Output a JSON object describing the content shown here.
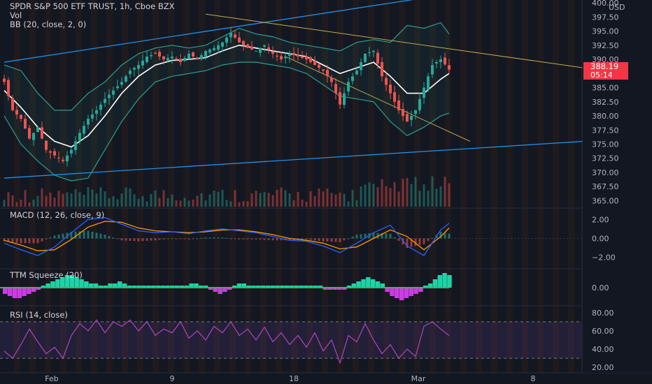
{
  "header": {
    "symbol_line": "SPDR S&P 500 ETF TRUST, 1h, Cboe BZX",
    "vol_label": "Vol",
    "bb_label": "BB (20, close, 2, 0)",
    "currency": "USD"
  },
  "price_tag": {
    "price": "388.19",
    "countdown": "05:14"
  },
  "indicators": {
    "macd_label": "MACD (12, 26, close, 9)",
    "ttm_label": "TTM Squeeze (20)",
    "rsi_label": "RSI (14, close)"
  },
  "colors": {
    "background": "#131722",
    "up": "#26a69a",
    "down": "#ef5350",
    "bb_band": "#2e9e8f",
    "bb_mid": "#ffffff",
    "channel": "#2196f3",
    "wedge": "#c9b458",
    "macd_line": "#2962ff",
    "signal_line": "#ff9800",
    "ttm_pos": "#1de9b6",
    "ttm_neg": "#e040fb",
    "rsi_line": "#ab47bc",
    "price_tag": "#f23645"
  },
  "chart_data": [
    {
      "type": "candlestick",
      "pane": "price",
      "title": "SPDR S&P 500 ETF TRUST, 1h, Cboe BZX",
      "ylabel": "USD",
      "ylim": [
        365,
        400
      ],
      "yticks": [
        365.0,
        367.5,
        370.0,
        372.5,
        375.0,
        377.5,
        380.0,
        382.5,
        385.0,
        387.5,
        390.0,
        392.5,
        395.0,
        397.5,
        400.0
      ],
      "yticklabels": [
        "365.00",
        "367.50",
        "370.00",
        "372.50",
        "375.00",
        "377.50",
        "380.00",
        "382.50",
        "385.00",
        "",
        "390.00",
        "392.50",
        "395.00",
        "397.50",
        "400.00"
      ],
      "xticklabels": [
        "Feb",
        "9",
        "18",
        "Mar",
        "8"
      ],
      "last_price": 388.19,
      "close_path": [
        [
          0,
          386
        ],
        [
          2,
          381
        ],
        [
          4,
          379.5
        ],
        [
          6,
          376
        ],
        [
          8,
          378
        ],
        [
          10,
          374
        ],
        [
          12,
          373
        ],
        [
          14,
          372
        ],
        [
          16,
          374
        ],
        [
          18,
          377
        ],
        [
          20,
          379.5
        ],
        [
          22,
          381
        ],
        [
          24,
          383
        ],
        [
          26,
          384.5
        ],
        [
          28,
          386
        ],
        [
          30,
          388
        ],
        [
          32,
          389
        ],
        [
          34,
          390.5
        ],
        [
          36,
          391
        ],
        [
          38,
          390
        ],
        [
          40,
          390.5
        ],
        [
          42,
          389.5
        ],
        [
          44,
          391
        ],
        [
          46,
          390
        ],
        [
          48,
          391.5
        ],
        [
          50,
          392
        ],
        [
          52,
          393
        ],
        [
          54,
          394.7
        ],
        [
          56,
          393
        ],
        [
          58,
          392
        ],
        [
          60,
          391.5
        ],
        [
          62,
          392.5
        ],
        [
          64,
          391
        ],
        [
          66,
          390
        ],
        [
          68,
          391
        ],
        [
          70,
          390.5
        ],
        [
          72,
          390
        ],
        [
          74,
          389
        ],
        [
          76,
          388
        ],
        [
          78,
          386
        ],
        [
          80,
          382
        ],
        [
          82,
          386
        ],
        [
          84,
          388
        ],
        [
          86,
          391
        ],
        [
          88,
          391.5
        ],
        [
          90,
          387
        ],
        [
          92,
          384
        ],
        [
          94,
          381
        ],
        [
          96,
          379
        ],
        [
          98,
          381
        ],
        [
          100,
          385
        ],
        [
          102,
          389
        ],
        [
          104,
          390
        ],
        [
          106,
          388.19
        ]
      ],
      "bb_upper": [
        [
          0,
          389
        ],
        [
          4,
          388
        ],
        [
          8,
          384
        ],
        [
          12,
          381
        ],
        [
          16,
          381
        ],
        [
          20,
          384
        ],
        [
          24,
          386
        ],
        [
          28,
          389
        ],
        [
          32,
          391
        ],
        [
          36,
          392
        ],
        [
          40,
          392.5
        ],
        [
          44,
          392
        ],
        [
          48,
          392.5
        ],
        [
          52,
          394
        ],
        [
          56,
          395.5
        ],
        [
          60,
          394.5
        ],
        [
          64,
          394
        ],
        [
          68,
          393
        ],
        [
          72,
          392.5
        ],
        [
          76,
          392
        ],
        [
          80,
          391.5
        ],
        [
          84,
          393
        ],
        [
          88,
          393.5
        ],
        [
          92,
          393
        ],
        [
          96,
          396
        ],
        [
          100,
          395.5
        ],
        [
          104,
          396.5
        ],
        [
          106,
          394.5
        ]
      ],
      "bb_middle": [
        [
          0,
          384.5
        ],
        [
          4,
          381.5
        ],
        [
          8,
          378
        ],
        [
          12,
          375.5
        ],
        [
          16,
          374.5
        ],
        [
          20,
          376.5
        ],
        [
          24,
          380
        ],
        [
          28,
          384
        ],
        [
          32,
          387
        ],
        [
          36,
          389
        ],
        [
          40,
          389.8
        ],
        [
          44,
          390
        ],
        [
          48,
          390.3
        ],
        [
          52,
          391.5
        ],
        [
          56,
          392.5
        ],
        [
          60,
          392
        ],
        [
          64,
          391.5
        ],
        [
          68,
          391
        ],
        [
          72,
          390.5
        ],
        [
          76,
          389
        ],
        [
          80,
          387.5
        ],
        [
          84,
          388.5
        ],
        [
          88,
          389.5
        ],
        [
          92,
          387
        ],
        [
          96,
          384
        ],
        [
          100,
          384
        ],
        [
          104,
          386.5
        ],
        [
          106,
          387.5
        ]
      ],
      "bb_lower": [
        [
          0,
          380
        ],
        [
          4,
          375
        ],
        [
          8,
          372
        ],
        [
          12,
          369.5
        ],
        [
          16,
          368.5
        ],
        [
          20,
          369
        ],
        [
          24,
          374
        ],
        [
          28,
          379
        ],
        [
          32,
          383
        ],
        [
          36,
          386
        ],
        [
          40,
          387
        ],
        [
          44,
          387.5
        ],
        [
          48,
          388
        ],
        [
          52,
          389
        ],
        [
          56,
          389.5
        ],
        [
          60,
          389.5
        ],
        [
          64,
          389
        ],
        [
          68,
          388.5
        ],
        [
          72,
          387.5
        ],
        [
          76,
          385.5
        ],
        [
          80,
          383.5
        ],
        [
          84,
          383
        ],
        [
          88,
          382.5
        ],
        [
          92,
          379
        ],
        [
          96,
          376.5
        ],
        [
          100,
          378
        ],
        [
          104,
          380
        ],
        [
          106,
          380.5
        ]
      ],
      "trendlines": [
        {
          "name": "channel-upper",
          "from": [
            0,
            389.5
          ],
          "to": [
            110,
            402
          ]
        },
        {
          "name": "channel-lower",
          "from": [
            0,
            369
          ],
          "to": [
            138,
            375.5
          ]
        },
        {
          "name": "wedge-upper",
          "from": [
            48,
            398
          ],
          "to": [
            138,
            388.5
          ]
        },
        {
          "name": "wedge-lower",
          "from": [
            67,
            390.5
          ],
          "to": [
            111,
            375.5
          ]
        }
      ]
    },
    {
      "type": "line",
      "pane": "macd",
      "title": "MACD (12, 26, close, 9)",
      "ylim": [
        -3,
        3
      ],
      "yticklabels": [
        "−2.00",
        "0.00",
        "2.00"
      ],
      "yticks": [
        -2,
        0,
        2
      ],
      "series": [
        {
          "values": [
            [
              0,
              -0.5
            ],
            [
              4,
              -1.2
            ],
            [
              8,
              -1.8
            ],
            [
              12,
              -0.9
            ],
            [
              16,
              0.6
            ],
            [
              20,
              2.0
            ],
            [
              24,
              2.2
            ],
            [
              28,
              1.5
            ],
            [
              32,
              0.8
            ],
            [
              36,
              0.6
            ],
            [
              40,
              0.7
            ],
            [
              44,
              0.5
            ],
            [
              48,
              0.8
            ],
            [
              52,
              1.0
            ],
            [
              56,
              0.8
            ],
            [
              60,
              0.6
            ],
            [
              64,
              0.2
            ],
            [
              68,
              -0.2
            ],
            [
              72,
              -0.3
            ],
            [
              76,
              -0.8
            ],
            [
              80,
              -1.5
            ],
            [
              84,
              -0.5
            ],
            [
              88,
              0.6
            ],
            [
              92,
              1.4
            ],
            [
              96,
              -0.8
            ],
            [
              100,
              -1.8
            ],
            [
              104,
              0.9
            ],
            [
              106,
              1.6
            ]
          ]
        },
        {
          "values": [
            [
              0,
              -0.2
            ],
            [
              4,
              -0.7
            ],
            [
              8,
              -1.3
            ],
            [
              12,
              -1.2
            ],
            [
              16,
              -0.1
            ],
            [
              20,
              1.2
            ],
            [
              24,
              1.8
            ],
            [
              28,
              1.7
            ],
            [
              32,
              1.1
            ],
            [
              36,
              0.8
            ],
            [
              40,
              0.7
            ],
            [
              44,
              0.6
            ],
            [
              48,
              0.7
            ],
            [
              52,
              0.9
            ],
            [
              56,
              0.9
            ],
            [
              60,
              0.7
            ],
            [
              64,
              0.4
            ],
            [
              68,
              0.0
            ],
            [
              72,
              -0.2
            ],
            [
              76,
              -0.5
            ],
            [
              80,
              -1.1
            ],
            [
              84,
              -0.9
            ],
            [
              88,
              0.0
            ],
            [
              92,
              0.9
            ],
            [
              96,
              0.2
            ],
            [
              100,
              -1.2
            ],
            [
              104,
              0.2
            ],
            [
              106,
              1.1
            ]
          ]
        }
      ]
    },
    {
      "type": "bar",
      "pane": "ttm",
      "title": "TTM Squeeze (20)",
      "yticklabels": [
        "0.00"
      ],
      "values": [
        -3,
        -4,
        -5,
        -5,
        -4,
        -3,
        -2,
        -1,
        1,
        2,
        3,
        4,
        5,
        6,
        6,
        5,
        4,
        3,
        2,
        2,
        1,
        1,
        2,
        2,
        3,
        2,
        1,
        1,
        1,
        1,
        1,
        1,
        1,
        1,
        1,
        1,
        1,
        1,
        1,
        2,
        2,
        1,
        1,
        -1,
        -2,
        -3,
        -2,
        -1,
        1,
        2,
        2,
        1,
        1,
        1,
        1,
        1,
        1,
        1,
        1,
        1,
        1,
        1,
        1,
        1,
        1,
        1,
        1,
        -1,
        -1,
        -1,
        -1,
        -1,
        1,
        2,
        3,
        4,
        5,
        4,
        3,
        2,
        -2,
        -4,
        -5,
        -6,
        -5,
        -4,
        -3,
        -2,
        1,
        2,
        4,
        6,
        7,
        6
      ]
    },
    {
      "type": "line",
      "pane": "rsi",
      "title": "RSI (14, close)",
      "ylim": [
        15,
        85
      ],
      "yticks": [
        20,
        40,
        60,
        80
      ],
      "yticklabels": [
        "20.00",
        "40.00",
        "60.00",
        "80.00"
      ],
      "band": [
        30,
        70
      ],
      "values": [
        [
          0,
          38
        ],
        [
          2,
          30
        ],
        [
          4,
          45
        ],
        [
          6,
          62
        ],
        [
          8,
          48
        ],
        [
          10,
          35
        ],
        [
          12,
          42
        ],
        [
          14,
          30
        ],
        [
          16,
          55
        ],
        [
          18,
          68
        ],
        [
          20,
          60
        ],
        [
          22,
          72
        ],
        [
          24,
          58
        ],
        [
          26,
          70
        ],
        [
          28,
          65
        ],
        [
          30,
          72
        ],
        [
          32,
          60
        ],
        [
          34,
          70
        ],
        [
          36,
          55
        ],
        [
          38,
          62
        ],
        [
          40,
          58
        ],
        [
          42,
          70
        ],
        [
          44,
          52
        ],
        [
          46,
          60
        ],
        [
          48,
          50
        ],
        [
          50,
          65
        ],
        [
          52,
          58
        ],
        [
          54,
          70
        ],
        [
          56,
          55
        ],
        [
          58,
          62
        ],
        [
          60,
          50
        ],
        [
          62,
          64
        ],
        [
          64,
          48
        ],
        [
          66,
          58
        ],
        [
          68,
          45
        ],
        [
          70,
          55
        ],
        [
          72,
          42
        ],
        [
          74,
          58
        ],
        [
          76,
          38
        ],
        [
          78,
          50
        ],
        [
          80,
          25
        ],
        [
          82,
          55
        ],
        [
          84,
          48
        ],
        [
          86,
          68
        ],
        [
          88,
          50
        ],
        [
          90,
          35
        ],
        [
          92,
          45
        ],
        [
          94,
          30
        ],
        [
          96,
          40
        ],
        [
          98,
          32
        ],
        [
          100,
          65
        ],
        [
          102,
          70
        ],
        [
          104,
          62
        ],
        [
          106,
          55
        ]
      ]
    }
  ]
}
